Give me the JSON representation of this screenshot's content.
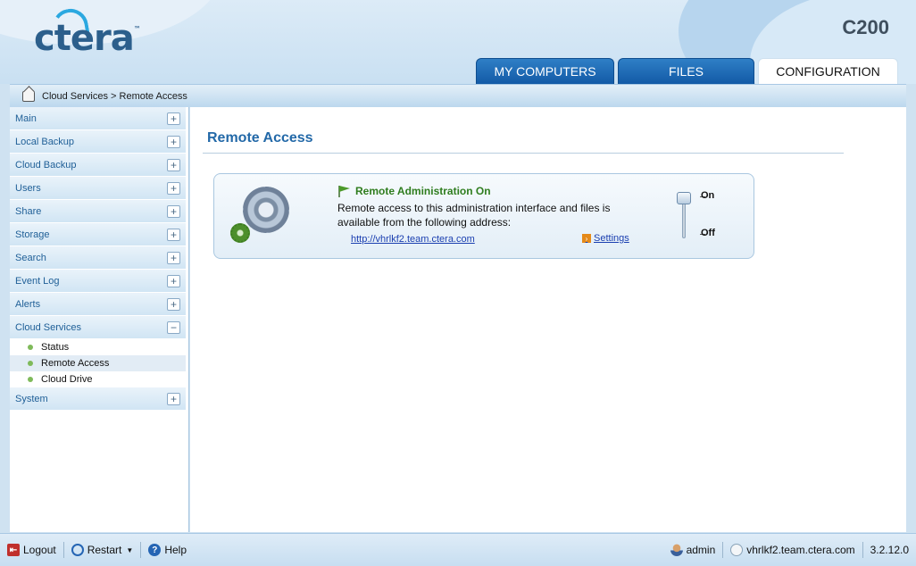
{
  "header": {
    "logo": "ctera",
    "logo_tm": "™",
    "model": "C200",
    "tabs": [
      {
        "label": "MY COMPUTERS",
        "active": false
      },
      {
        "label": "FILES",
        "active": false
      },
      {
        "label": "CONFIGURATION",
        "active": true
      }
    ]
  },
  "breadcrumb": "Cloud Services > Remote Access",
  "sidebar": {
    "items": [
      {
        "label": "Main",
        "toggle": "+"
      },
      {
        "label": "Local Backup",
        "toggle": "+"
      },
      {
        "label": "Cloud Backup",
        "toggle": "+"
      },
      {
        "label": "Users",
        "toggle": "+"
      },
      {
        "label": "Share",
        "toggle": "+"
      },
      {
        "label": "Storage",
        "toggle": "+"
      },
      {
        "label": "Search",
        "toggle": "+"
      },
      {
        "label": "Event Log",
        "toggle": "+"
      },
      {
        "label": "Alerts",
        "toggle": "+"
      },
      {
        "label": "Cloud Services",
        "toggle": "−"
      }
    ],
    "sub_items": [
      {
        "label": "Status",
        "active": false
      },
      {
        "label": "Remote Access",
        "active": true
      },
      {
        "label": "Cloud Drive",
        "active": false
      }
    ],
    "last_item": {
      "label": "System",
      "toggle": "+"
    }
  },
  "main": {
    "title": "Remote Access",
    "card": {
      "title": "Remote Administration On",
      "description": "Remote access to this administration interface and files is available from the following address:",
      "link": "http://vhrlkf2.team.ctera.com",
      "settings": "Settings",
      "switch_on": "On",
      "switch_off": "Off",
      "state": "on"
    }
  },
  "footer": {
    "logout": "Logout",
    "restart": "Restart",
    "help": "Help",
    "user": "admin",
    "host": "vhrlkf2.team.ctera.com",
    "version": "3.2.12.0"
  },
  "colors": {
    "accent": "#2369a8",
    "tab_active_bg": "#ffffff",
    "tab_bg": "#1a64ae",
    "status_on": "#2f7d1e"
  }
}
